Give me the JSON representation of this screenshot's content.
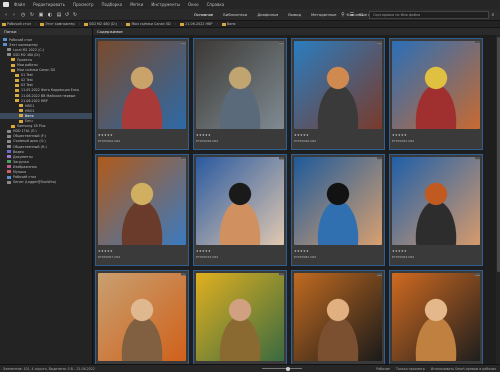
{
  "menu": [
    "Файл",
    "Редактировать",
    "Просмотр",
    "Подборка",
    "Метки",
    "Инструменты",
    "Окно",
    "Справка"
  ],
  "toolbar": {
    "workspaces": [
      "Основное",
      "Библиотеки",
      "Диафильм",
      "Вывод",
      "Метаданные",
      "Ключевые слова"
    ],
    "search_placeholder": "Сортировка по Имя файла"
  },
  "path": [
    "Рабочий стол",
    "Этот компьютер",
    "SSD M2 480 (D:)",
    "Мои съёмки Canon 5D",
    "21.06.2022 НВР",
    "Ваня"
  ],
  "panel_title": "Папки",
  "tree": [
    {
      "label": "Рабочий стол",
      "ico": "pc",
      "indent": 0
    },
    {
      "label": "Этот компьютер",
      "ico": "pc",
      "indent": 0
    },
    {
      "label": "Local M2 2022 (C:)",
      "ico": "drive",
      "indent": 1
    },
    {
      "label": "SSD M2 480 (D:)",
      "ico": "drive",
      "indent": 1
    },
    {
      "label": "Проекты",
      "ico": "folder",
      "indent": 2
    },
    {
      "label": "Мои работы",
      "ico": "folder",
      "indent": 2
    },
    {
      "label": "Мои съёмки Canon 5D",
      "ico": "folder",
      "indent": 2
    },
    {
      "label": "01 Test",
      "ico": "folder",
      "indent": 3
    },
    {
      "label": "02 Test",
      "ico": "folder",
      "indent": 3
    },
    {
      "label": "03 Test",
      "ico": "folder",
      "indent": 3
    },
    {
      "label": "11.05.2022 Фото Коррекция Ёлка",
      "ico": "folder",
      "indent": 3
    },
    {
      "label": "11.06.2022 ВВ Майские первые",
      "ico": "folder",
      "indent": 3
    },
    {
      "label": "21.06.2022 НВР",
      "ico": "folder",
      "indent": 3
    },
    {
      "label": "НВО1",
      "ico": "folder",
      "indent": 4
    },
    {
      "label": "НВО2",
      "ico": "folder",
      "indent": 4
    },
    {
      "label": "Ваня",
      "ico": "folder",
      "indent": 4,
      "selected": true
    },
    {
      "label": "Eeru",
      "ico": "folder",
      "indent": 4
    },
    {
      "label": "Samsung 1B Plus",
      "ico": "folder",
      "indent": 2
    },
    {
      "label": "HDD 1Tb1 (E:)",
      "ico": "drive",
      "indent": 1
    },
    {
      "label": "Общественный (F:)",
      "ico": "drive",
      "indent": 1
    },
    {
      "label": "Съемный диск (G:)",
      "ico": "drive",
      "indent": 1
    },
    {
      "label": "Общественный (H:)",
      "ico": "drive",
      "indent": 1
    },
    {
      "label": "Видео",
      "ico": "video",
      "indent": 1
    },
    {
      "label": "Документы",
      "ico": "doc",
      "indent": 1
    },
    {
      "label": "Загрузки",
      "ico": "green",
      "indent": 1
    },
    {
      "label": "Изображения",
      "ico": "img",
      "indent": 1
    },
    {
      "label": "Музыка",
      "ico": "music",
      "indent": 1
    },
    {
      "label": "Рабочий стол",
      "ico": "pc",
      "indent": 1
    },
    {
      "label": "Server (Logger@GooWho)",
      "ico": "drive",
      "indent": 1
    }
  ],
  "content_tab": "Содержимое",
  "thumbs": [
    {
      "file": "P7070002.CR2",
      "palette": [
        "#7a4a2c",
        "#2d6aa8",
        "#c9a36a",
        "#a83a3a"
      ]
    },
    {
      "file": "P7070028.CR2",
      "palette": [
        "#3d3a36",
        "#7f8b92",
        "#c0a570",
        "#5a6a7a"
      ]
    },
    {
      "file": "P7070040.CR2",
      "palette": [
        "#2a7dc0",
        "#7a3a2a",
        "#d08a50",
        "#3a3a3a"
      ]
    },
    {
      "file": "P7070052.CR2",
      "palette": [
        "#2a6fb8",
        "#c86a30",
        "#e0c040",
        "#a03030"
      ]
    },
    {
      "file": "P7070057.CR2",
      "palette": [
        "#b05a1a",
        "#3a7ac0",
        "#d0b060",
        "#6a3a2a"
      ]
    },
    {
      "file": "P7070074.CR2",
      "palette": [
        "#2a5aa0",
        "#e0c8b0",
        "#1a1a1a",
        "#d09060"
      ]
    },
    {
      "file": "P7070081.CR2",
      "palette": [
        "#1e5a9a",
        "#d8a070",
        "#121212",
        "#3070b0"
      ]
    },
    {
      "file": "P7070093.CR2",
      "palette": [
        "#1f5fa8",
        "#d69a6c",
        "#c05a20",
        "#2d2d2d"
      ]
    },
    {
      "file": "P7070101.CR2",
      "palette": [
        "#c8a070",
        "#d0601a",
        "#e0b890",
        "#806040"
      ]
    },
    {
      "file": "P7070112.CR2",
      "palette": [
        "#e0b020",
        "#3a6a40",
        "#d0a080",
        "#8a6a30"
      ]
    },
    {
      "file": "P7070125.CR2",
      "palette": [
        "#c06a20",
        "#1a1a1a",
        "#e0b080",
        "#7a5030"
      ]
    },
    {
      "file": "P7070131.CR2",
      "palette": [
        "#d06a20",
        "#1e1e1e",
        "#e4b88a",
        "#c08040"
      ]
    }
  ],
  "rating": "★★★★★",
  "ext_badge": "RAW",
  "status": {
    "left": "Элементов: 101, 4 скрыто, Выделено: 0 B – 21.06.2022",
    "right": [
      "Рабочие",
      "Только просмотр",
      "Использовать Smart-превью в рабочих"
    ]
  }
}
